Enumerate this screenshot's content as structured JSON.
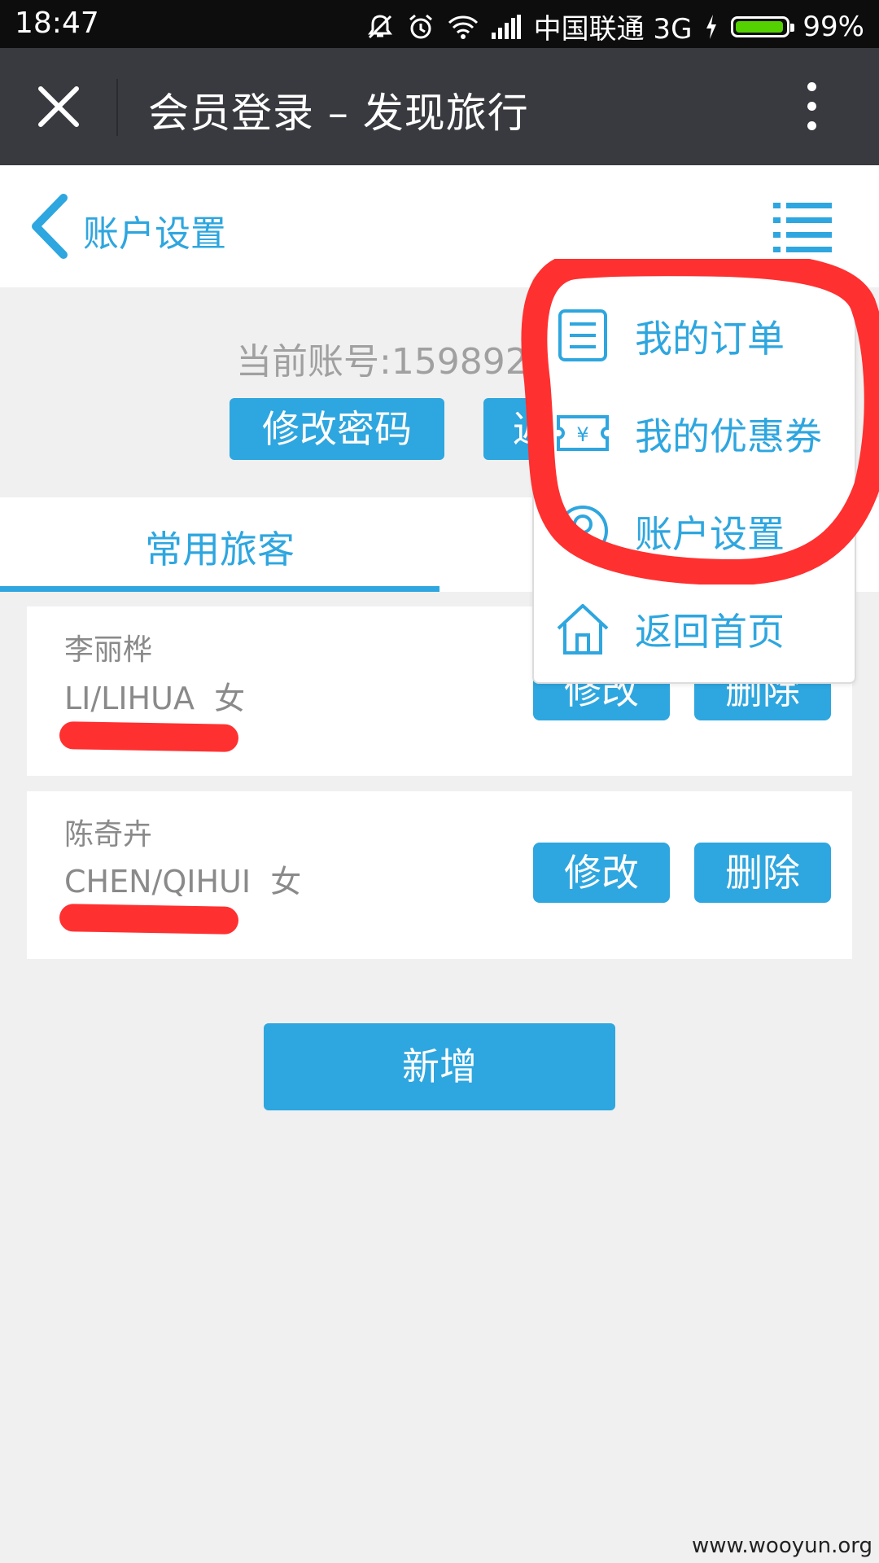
{
  "status_bar": {
    "time": "18:47",
    "carrier": "中国联通 3G",
    "battery": "99%",
    "icons": [
      "mute-icon",
      "alarm-icon",
      "wifi-icon",
      "signal-icon",
      "charging-icon",
      "battery-icon"
    ]
  },
  "titlebar": {
    "title": "会员登录 – 发现旅行"
  },
  "header": {
    "title": "账户设置"
  },
  "account": {
    "label": "当前账号:159892",
    "change_password": "修改密码",
    "return_label": "返"
  },
  "tabs": {
    "active": "常用旅客"
  },
  "travelers": [
    {
      "name": "李丽桦",
      "pinyin": "LI/LIHUA",
      "gender": "女",
      "edit": "修改",
      "delete": "删除"
    },
    {
      "name": "陈奇卉",
      "pinyin": "CHEN/QIHUI",
      "gender": "女",
      "edit": "修改",
      "delete": "删除"
    }
  ],
  "add_button": "新增",
  "dropdown": {
    "items": [
      {
        "label": "我的订单",
        "icon": "order-list-icon"
      },
      {
        "label": "我的优惠券",
        "icon": "coupon-icon"
      },
      {
        "label": "账户设置",
        "icon": "user-account-icon"
      },
      {
        "label": "返回首页",
        "icon": "home-icon"
      }
    ]
  },
  "colors": {
    "accent": "#2ea6df",
    "titlebar": "#393a3f",
    "annotation": "#ff3030"
  },
  "watermark": "www.wooyun.org"
}
